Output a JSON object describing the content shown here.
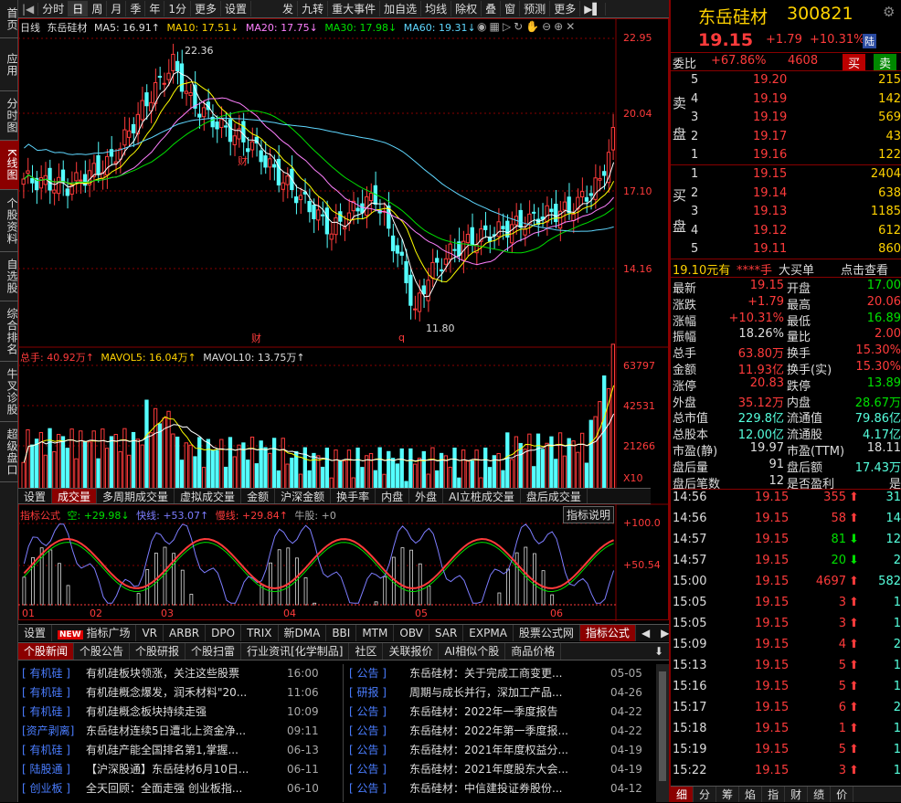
{
  "left_tabs": [
    "首页",
    "应用",
    "分时图",
    "K线图",
    "个股资料",
    "自选股",
    "综合排名",
    "牛叉诊股",
    "超级盘口"
  ],
  "toolbar": [
    "分时",
    "日",
    "周",
    "月",
    "季",
    "年",
    "1分",
    "更多",
    "设置",
    "发",
    "九转",
    "重大事件",
    "加自选",
    "均线",
    "除权",
    "叠",
    "窗",
    "预测",
    "更多"
  ],
  "ma_line": {
    "prefix": "日线",
    "name": "东岳硅材",
    "ma5": "MA5: 16.91↑",
    "ma10": "MA10: 17.51↓",
    "ma20": "MA20: 17.75↓",
    "ma30": "MA30: 17.98↓",
    "ma60": "MA60: 19.31↓"
  },
  "price_axis": [
    "22.95",
    "20.04",
    "17.10",
    "14.16"
  ],
  "price_marks": {
    "high": "22.36",
    "low": "11.80",
    "cai1": "财",
    "cai2": "财",
    "q": "q"
  },
  "vol_line": {
    "total": "总手: 40.92万↑",
    "mavol5": "MAVOL5: 16.04万↑",
    "mavol10": "MAVOL10: 13.75万↑"
  },
  "vol_axis": [
    "63797",
    "42531",
    "21266",
    "X10"
  ],
  "sub_tabs": [
    "设置",
    "成交量",
    "多周期成交量",
    "虚拟成交量",
    "金额",
    "沪深金额",
    "换手率",
    "内盘",
    "外盘",
    "AI立桩成交量",
    "盘后成交量"
  ],
  "ind_line": {
    "name": "指标公式",
    "kong": "空: +29.98↓",
    "fast": "快线: +53.07↑",
    "slow": "慢线: +29.84↑",
    "bull": "牛股: +0",
    "explain": "指标说明"
  },
  "ind_axis": [
    "+100.0",
    "+50.54"
  ],
  "months": [
    "01",
    "02",
    "03",
    "04",
    "05",
    "06"
  ],
  "bottom_tabs": [
    "设置",
    "指标广场",
    "VR",
    "ARBR",
    "DPO",
    "TRIX",
    "新DMA",
    "BBI",
    "MTM",
    "OBV",
    "SAR",
    "EXPMA",
    "股票公式网",
    "指标公式"
  ],
  "new_badge": "NEW",
  "news_tabs": [
    "个股新闻",
    "个股公告",
    "个股研报",
    "个股扫雷",
    "行业资讯[化学制品]",
    "社区",
    "关联报价",
    "AI相似个股",
    "商品价格"
  ],
  "news_left": [
    {
      "tag": "[ 有机硅 ]",
      "title": "有机硅板块领涨，关注这些股票",
      "time": "16:00"
    },
    {
      "tag": "[ 有机硅 ]",
      "title": "有机硅概念爆发，润禾材料\"20...",
      "time": "11:06"
    },
    {
      "tag": "[ 有机硅 ]",
      "title": "有机硅概念板块持续走强",
      "time": "10:09"
    },
    {
      "tag": "[资产剥离]",
      "title": "东岳硅材连续5日遭北上资金净...",
      "time": "09:11"
    },
    {
      "tag": "[ 有机硅 ]",
      "title": "有机硅产能全国排名第1,掌握...",
      "time": "06-13"
    },
    {
      "tag": "[ 陆股通 ]",
      "title": "【沪深股通】东岳硅材6月10日...",
      "time": "06-11"
    },
    {
      "tag": "[ 创业板 ]",
      "title": "全天回顾：全面走强 创业板指...",
      "time": "06-10"
    }
  ],
  "news_right": [
    {
      "tag": "[ 公告 ]",
      "title": "东岳硅材：关于完成工商变更...",
      "time": "05-05"
    },
    {
      "tag": "[ 研报 ]",
      "title": "周期与成长并行，深加工产品...",
      "time": "04-26"
    },
    {
      "tag": "[ 公告 ]",
      "title": "东岳硅材：2022年一季度报告",
      "time": "04-22"
    },
    {
      "tag": "[ 公告 ]",
      "title": "东岳硅材：2022年第一季度报...",
      "time": "04-22"
    },
    {
      "tag": "[ 公告 ]",
      "title": "东岳硅材：2021年年度权益分...",
      "time": "04-19"
    },
    {
      "tag": "[ 公告 ]",
      "title": "东岳硅材：2021年度股东大会...",
      "time": "04-19"
    },
    {
      "tag": "[ 公告 ]",
      "title": "东岳硅材：中信建投证券股份...",
      "time": "04-12"
    }
  ],
  "stock": {
    "name": "东岳硅材",
    "code": "300821",
    "price": "19.15",
    "change": "+1.79",
    "pct": "+10.31%",
    "tag": "陆"
  },
  "weibi": {
    "label": "委比",
    "pct": "+67.86%",
    "val": "4608",
    "buy": "买",
    "sell": "卖"
  },
  "sells": [
    [
      "5",
      "19.20",
      "215"
    ],
    [
      "4",
      "19.19",
      "142"
    ],
    [
      "3",
      "19.19",
      "569"
    ],
    [
      "2",
      "19.17",
      "43"
    ],
    [
      "1",
      "19.16",
      "122"
    ]
  ],
  "buys": [
    [
      "1",
      "19.15",
      "2404"
    ],
    [
      "2",
      "19.14",
      "638"
    ],
    [
      "3",
      "19.13",
      "1185"
    ],
    [
      "4",
      "19.12",
      "612"
    ],
    [
      "5",
      "19.11",
      "860"
    ]
  ],
  "sell_label": [
    "卖",
    "盘"
  ],
  "buy_label": [
    "买",
    "盘"
  ],
  "bigorder": {
    "price": "19.10元有",
    "hands": "****手",
    "big": "大买单",
    "check": "点击查看"
  },
  "stats": [
    [
      "最新",
      "19.15",
      "开盘",
      "17.00"
    ],
    [
      "涨跌",
      "+1.79",
      "最高",
      "20.06"
    ],
    [
      "涨幅",
      "+10.31%",
      "最低",
      "16.89"
    ],
    [
      "振幅",
      "18.26%",
      "量比",
      "2.00"
    ],
    [
      "总手",
      "63.80万",
      "换手",
      "15.30%"
    ],
    [
      "金额",
      "11.93亿",
      "换手(实)",
      "15.30%"
    ],
    [
      "涨停",
      "20.83",
      "跌停",
      "13.89"
    ],
    [
      "外盘",
      "35.12万",
      "内盘",
      "28.67万"
    ],
    [
      "总市值",
      "229.8亿",
      "流通值",
      "79.86亿"
    ],
    [
      "总股本",
      "12.00亿",
      "流通股",
      "4.17亿"
    ],
    [
      "市盈(静)",
      "19.97",
      "市盈(TTM)",
      "18.11"
    ],
    [
      "盘后量",
      "91",
      "盘后额",
      "17.43万"
    ],
    [
      "盘后笔数",
      "12",
      "是否盈利",
      "是"
    ]
  ],
  "ticks": [
    [
      "14:56",
      "19.15",
      "355",
      "up",
      "31"
    ],
    [
      "14:56",
      "19.15",
      "58",
      "up",
      "14"
    ],
    [
      "14:57",
      "19.15",
      "81",
      "down",
      "12"
    ],
    [
      "14:57",
      "19.15",
      "20",
      "down",
      "2"
    ],
    [
      "15:00",
      "19.15",
      "4697",
      "up",
      "582"
    ],
    [
      "15:05",
      "19.15",
      "3",
      "up",
      "1"
    ],
    [
      "15:05",
      "19.15",
      "3",
      "up",
      "1"
    ],
    [
      "15:09",
      "19.15",
      "4",
      "up",
      "2"
    ],
    [
      "15:13",
      "19.15",
      "5",
      "up",
      "1"
    ],
    [
      "15:16",
      "19.15",
      "5",
      "up",
      "1"
    ],
    [
      "15:17",
      "19.15",
      "6",
      "up",
      "2"
    ],
    [
      "15:18",
      "19.15",
      "1",
      "up",
      "1"
    ],
    [
      "15:19",
      "19.15",
      "5",
      "up",
      "1"
    ],
    [
      "15:22",
      "19.15",
      "3",
      "up",
      "1"
    ]
  ],
  "rp_bottom": [
    "细",
    "分",
    "筹",
    "焰",
    "指",
    "财",
    "绩",
    "价"
  ],
  "colors": {
    "up": "#ff3b3b",
    "down": "#00e000",
    "cyan": "#54ffff",
    "ma5": "#ffffff",
    "ma10": "#ffff00",
    "ma20": "#ff80ff",
    "ma30": "#00e000",
    "ma60": "#5fd7ff"
  }
}
